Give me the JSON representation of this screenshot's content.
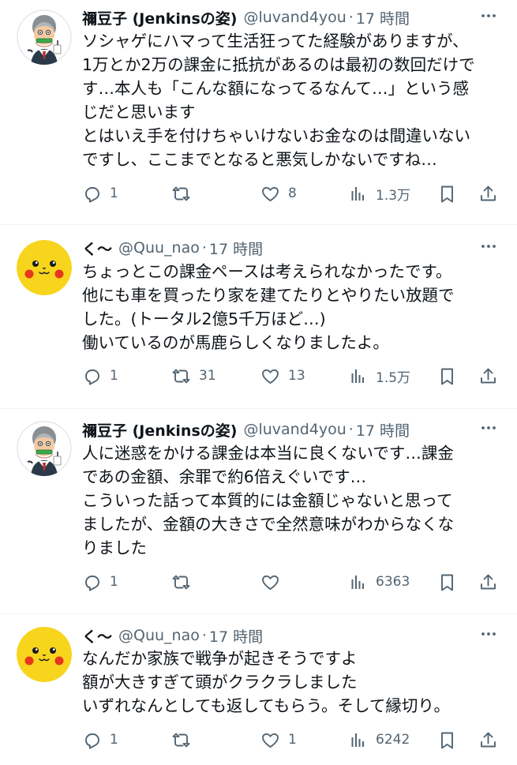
{
  "tweets": [
    {
      "name": "禰豆子 (Jenkinsの姿)",
      "handle": "@luvand4you",
      "time": "17 時間",
      "avatar": "jenkins-avatar",
      "lines": [
        "ソシャゲにハマって生活狂ってた経験がありますが、",
        "1万とか2万の課金に抵抗があるのは最初の数回だけで",
        "す…本人も「こんな額になってるなんて…」という感",
        "じだと思います",
        "とはいえ手を付けちゃいけないお金なのは間違いない",
        "ですし、ここまでとなると悪気しかないですね…"
      ],
      "replies": "1",
      "retweets": "",
      "likes": "8",
      "views": "1.3万"
    },
    {
      "name": "く〜",
      "handle": "@Quu_nao",
      "time": "17 時間",
      "avatar": "pikachu-avatar",
      "lines": [
        "ちょっとこの課金ペースは考えられなかったです。",
        "他にも車を買ったり家を建てたりとやりたい放題で",
        "した。(トータル2億5千万ほど…)",
        "働いているのが馬鹿らしくなりましたよ。"
      ],
      "replies": "1",
      "retweets": "31",
      "likes": "13",
      "views": "1.5万"
    },
    {
      "name": "禰豆子 (Jenkinsの姿)",
      "handle": "@luvand4you",
      "time": "17 時間",
      "avatar": "jenkins-avatar",
      "lines": [
        "人に迷惑をかける課金は本当に良くないです…課金",
        "であの金額、余罪で約6倍えぐいです…",
        "こういった話って本質的には金額じゃないと思って",
        "ましたが、金額の大きさで全然意味がわからなくな",
        "りました"
      ],
      "replies": "1",
      "retweets": "",
      "likes": "",
      "views": "6363"
    },
    {
      "name": "く〜",
      "handle": "@Quu_nao",
      "time": "17 時間",
      "avatar": "pikachu-avatar",
      "lines": [
        "なんだか家族で戦争が起きそうですよ",
        "額が大きすぎて頭がクラクラしました",
        "いずれなんとしても返してもらう。そして縁切り。"
      ],
      "replies": "1",
      "retweets": "",
      "likes": "1",
      "views": "6242"
    }
  ],
  "colors": {
    "text": "#0f1419",
    "secondary": "#536471",
    "divider": "#eff3f4",
    "pikachu": "#f7d51d",
    "cheek": "#e8361d"
  }
}
